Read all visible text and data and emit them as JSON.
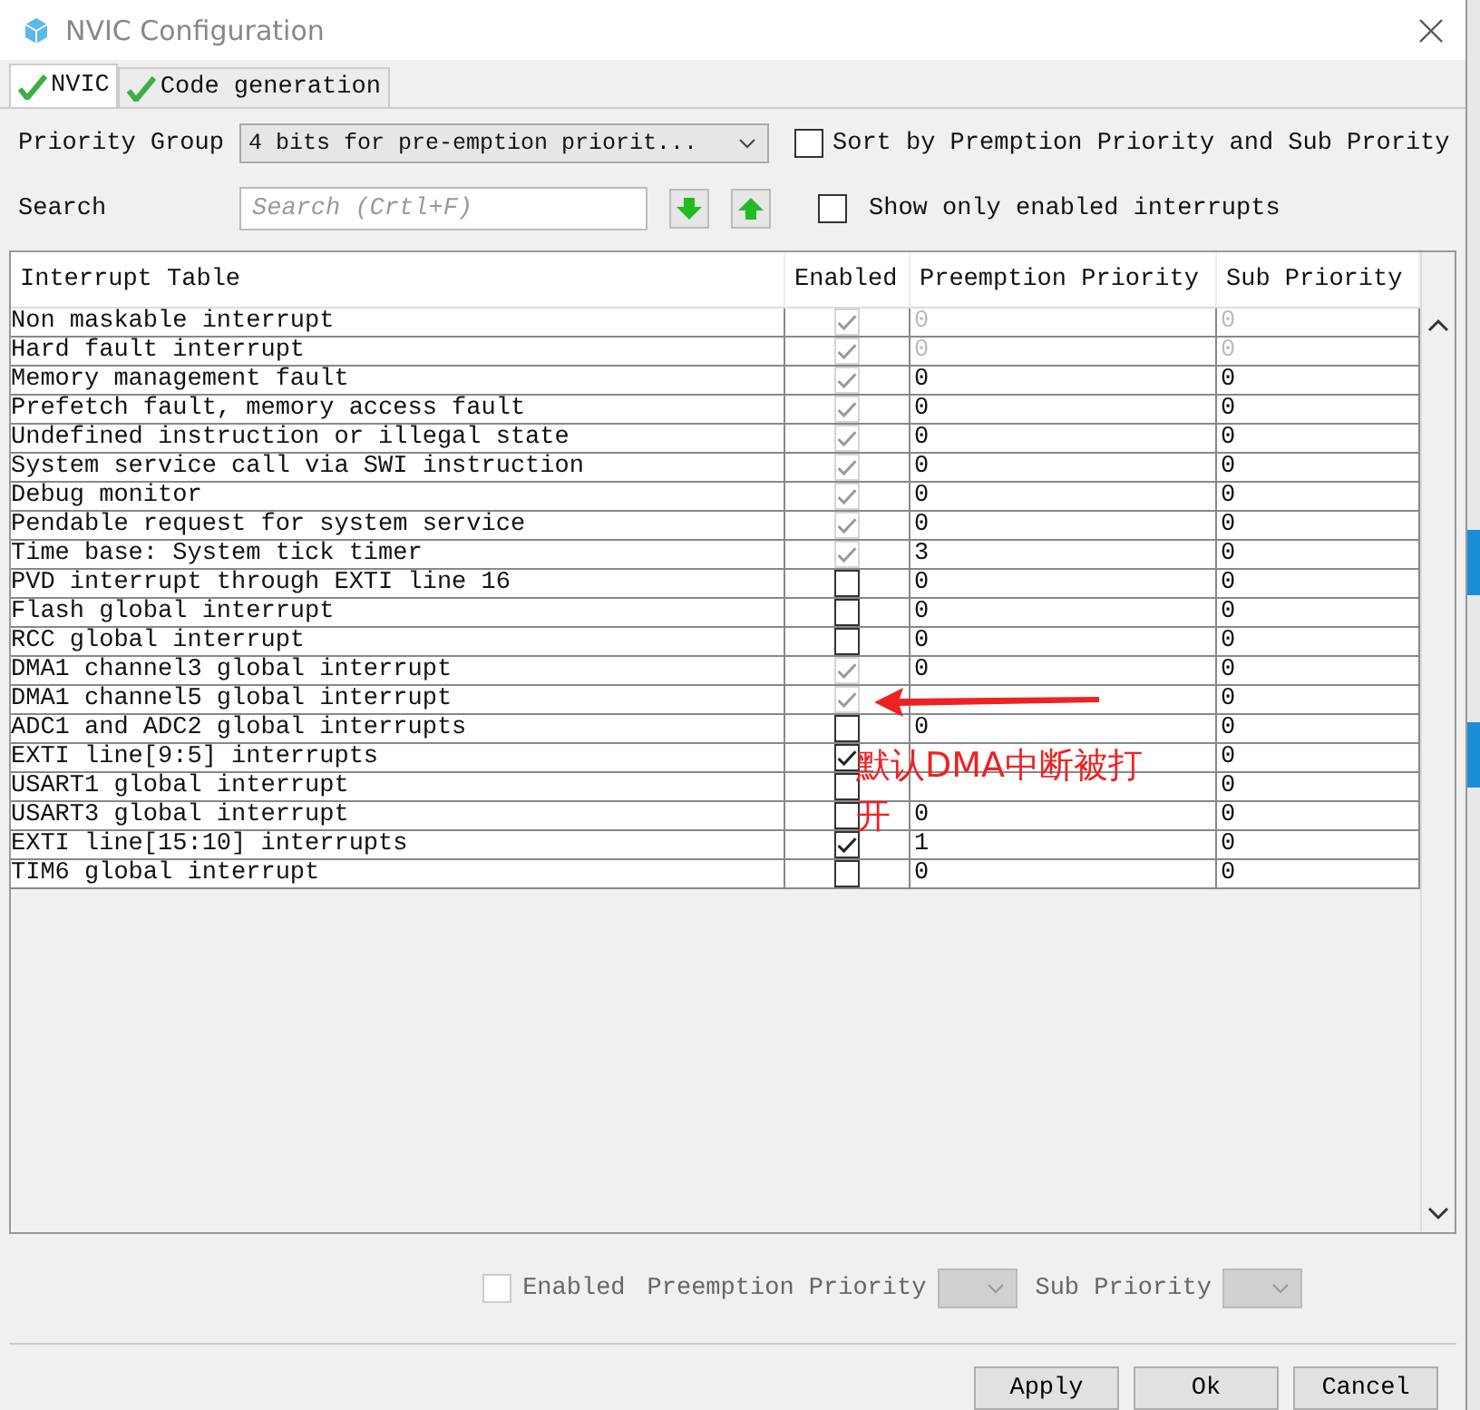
{
  "window": {
    "title": "NVIC Configuration"
  },
  "tabs": [
    {
      "label": "NVIC",
      "selected": true
    },
    {
      "label": "Code generation",
      "selected": false
    }
  ],
  "priority_group": {
    "label": "Priority Group",
    "value": "4 bits for pre-emption priorit..."
  },
  "sort_option": {
    "label": "Sort by Premption Priority and Sub Prority",
    "checked": false
  },
  "search": {
    "label": "Search",
    "placeholder": "Search (Crtl+F)"
  },
  "show_enabled_option": {
    "label": "Show only enabled interrupts",
    "checked": false
  },
  "table": {
    "columns": [
      "Interrupt Table",
      "Enabled",
      "Preemption Priority",
      "Sub Priority"
    ],
    "rows": [
      {
        "name": "Non maskable interrupt",
        "enabled": true,
        "locked": true,
        "priority_locked": true,
        "preemption": "0",
        "sub": "0"
      },
      {
        "name": "Hard fault interrupt",
        "enabled": true,
        "locked": true,
        "priority_locked": true,
        "preemption": "0",
        "sub": "0"
      },
      {
        "name": "Memory management fault",
        "enabled": true,
        "locked": true,
        "priority_locked": false,
        "preemption": "0",
        "sub": "0"
      },
      {
        "name": "Prefetch fault, memory access fault",
        "enabled": true,
        "locked": true,
        "priority_locked": false,
        "preemption": "0",
        "sub": "0"
      },
      {
        "name": "Undefined instruction or illegal state",
        "enabled": true,
        "locked": true,
        "priority_locked": false,
        "preemption": "0",
        "sub": "0"
      },
      {
        "name": "System service call via SWI instruction",
        "enabled": true,
        "locked": true,
        "priority_locked": false,
        "preemption": "0",
        "sub": "0"
      },
      {
        "name": "Debug monitor",
        "enabled": true,
        "locked": true,
        "priority_locked": false,
        "preemption": "0",
        "sub": "0"
      },
      {
        "name": "Pendable request for system service",
        "enabled": true,
        "locked": true,
        "priority_locked": false,
        "preemption": "0",
        "sub": "0"
      },
      {
        "name": "Time base: System tick timer",
        "enabled": true,
        "locked": true,
        "priority_locked": false,
        "preemption": "3",
        "sub": "0"
      },
      {
        "name": "PVD interrupt through EXTI line 16",
        "enabled": false,
        "locked": false,
        "priority_locked": false,
        "preemption": "0",
        "sub": "0"
      },
      {
        "name": "Flash global interrupt",
        "enabled": false,
        "locked": false,
        "priority_locked": false,
        "preemption": "0",
        "sub": "0"
      },
      {
        "name": "RCC global interrupt",
        "enabled": false,
        "locked": false,
        "priority_locked": false,
        "preemption": "0",
        "sub": "0"
      },
      {
        "name": "DMA1 channel3 global interrupt",
        "enabled": true,
        "locked": true,
        "priority_locked": false,
        "preemption": "0",
        "sub": "0"
      },
      {
        "name": "DMA1 channel5 global interrupt",
        "enabled": true,
        "locked": true,
        "priority_locked": false,
        "sub": "0"
      },
      {
        "name": "ADC1 and ADC2 global interrupts",
        "enabled": false,
        "locked": false,
        "priority_locked": false,
        "preemption": "0",
        "sub": "0"
      },
      {
        "name": "EXTI line[9:5] interrupts",
        "enabled": true,
        "locked": false,
        "priority_locked": false,
        "sub": "0"
      },
      {
        "name": "USART1 global interrupt",
        "enabled": false,
        "locked": false,
        "priority_locked": false,
        "sub": "0"
      },
      {
        "name": "USART3 global interrupt",
        "enabled": false,
        "locked": false,
        "priority_locked": false,
        "preemption": "0",
        "sub": "0"
      },
      {
        "name": "EXTI line[15:10] interrupts",
        "enabled": true,
        "locked": false,
        "priority_locked": false,
        "preemption": "1",
        "sub": "0"
      },
      {
        "name": "TIM6 global interrupt",
        "enabled": false,
        "locked": false,
        "priority_locked": false,
        "preemption": "0",
        "sub": "0"
      }
    ]
  },
  "annotation": {
    "lines": [
      "默认DMA中断被打",
      "开"
    ]
  },
  "selection": {
    "enabled_label": "Enabled",
    "enabled_checked": false,
    "preemption_label": "Preemption Priority",
    "sub_label": "Sub Priority"
  },
  "buttons": [
    "Apply",
    "Ok",
    "Cancel"
  ]
}
